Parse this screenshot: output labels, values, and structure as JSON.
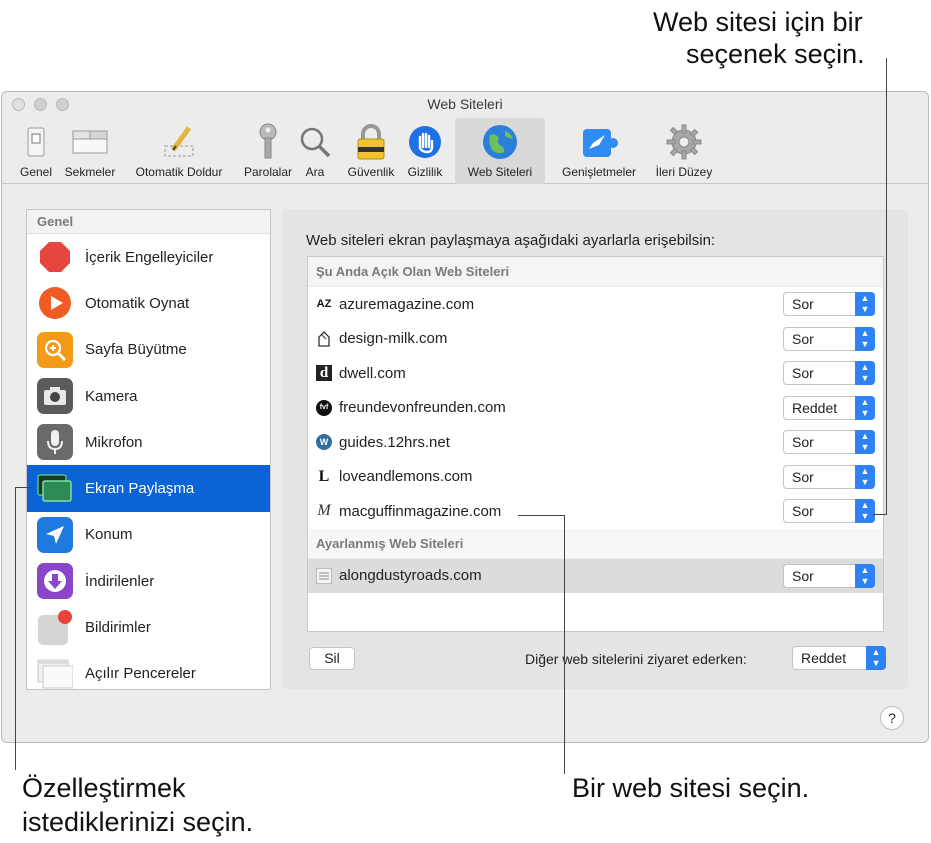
{
  "callouts": {
    "top_right_line1": "Web sitesi için bir",
    "top_right_line2": "seçenek seçin.",
    "bottom_left_line1": "Özelleştirmek",
    "bottom_left_line2": "istediklerinizi seçin.",
    "bottom_right": "Bir web sitesi seçin."
  },
  "window": {
    "title": "Web Siteleri"
  },
  "toolbar": {
    "items": [
      {
        "label": "Genel",
        "icon": "switch-icon"
      },
      {
        "label": "Sekmeler",
        "icon": "tabs-icon"
      },
      {
        "label": "Otomatik Doldur",
        "icon": "pencil-icon"
      },
      {
        "label": "Parolalar",
        "icon": "key-icon"
      },
      {
        "label": "Ara",
        "icon": "magnifier-icon"
      },
      {
        "label": "Güvenlik",
        "icon": "lock-icon"
      },
      {
        "label": "Gizlilik",
        "icon": "hand-icon"
      },
      {
        "label": "Web Siteleri",
        "icon": "globe-icon",
        "active": true
      },
      {
        "label": "Genişletmeler",
        "icon": "puzzle-icon"
      },
      {
        "label": "İleri Düzey",
        "icon": "gear-icon"
      }
    ]
  },
  "sidebar": {
    "header": "Genel",
    "items": [
      {
        "label": "İçerik Engelleyiciler",
        "icon": "stop-sign-icon",
        "color": "#e5463d"
      },
      {
        "label": "Otomatik Oynat",
        "icon": "play-icon",
        "color": "#f05a23"
      },
      {
        "label": "Sayfa Büyütme",
        "icon": "zoom-icon",
        "color": "#f39a1b"
      },
      {
        "label": "Kamera",
        "icon": "camera-icon",
        "color": "#5b5b5b"
      },
      {
        "label": "Mikrofon",
        "icon": "microphone-icon",
        "color": "#6a6a6a"
      },
      {
        "label": "Ekran Paylaşma",
        "icon": "screen-share-icon",
        "color": "#2e8a55",
        "selected": true
      },
      {
        "label": "Konum",
        "icon": "location-arrow-icon",
        "color": "#1f7ae0"
      },
      {
        "label": "İndirilenler",
        "icon": "download-icon",
        "color": "#8b45c9"
      },
      {
        "label": "Bildirimler",
        "icon": "notification-icon",
        "color": "#d0d0d0"
      },
      {
        "label": "Açılır Pencereler",
        "icon": "popup-window-icon",
        "color": "#e6e6e6"
      }
    ]
  },
  "panel": {
    "description": "Web siteleri ekran paylaşmaya aşağıdaki ayarlarla erişebilsin:",
    "open_header": "Şu Anda Açık Olan Web Siteleri",
    "open_sites": [
      {
        "name": "azuremagazine.com",
        "value": "Sor",
        "icon_text": "AZ"
      },
      {
        "name": "design-milk.com",
        "value": "Sor",
        "icon_text": ""
      },
      {
        "name": "dwell.com",
        "value": "Sor",
        "icon_text": "d"
      },
      {
        "name": "freundevonfreunden.com",
        "value": "Reddet",
        "icon_text": "fvf"
      },
      {
        "name": "guides.12hrs.net",
        "value": "Sor",
        "icon_text": "W"
      },
      {
        "name": "loveandlemons.com",
        "value": "Sor",
        "icon_text": "L"
      },
      {
        "name": "macguffinmagazine.com",
        "value": "Sor",
        "icon_text": "M"
      }
    ],
    "configured_header": "Ayarlanmış Web Siteleri",
    "configured_sites": [
      {
        "name": "alongdustyroads.com",
        "value": "Sor",
        "icon_text": ""
      }
    ],
    "delete_button": "Sil",
    "other_label": "Diğer web sitelerini ziyaret ederken:",
    "other_value": "Reddet"
  },
  "help_button": "?"
}
